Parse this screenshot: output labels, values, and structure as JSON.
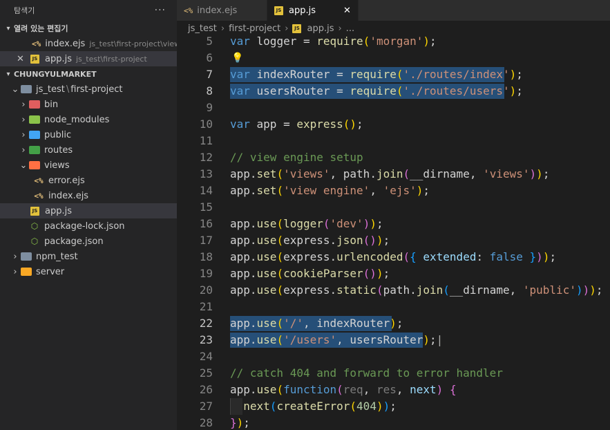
{
  "sidebar": {
    "title": "탐색기",
    "more": "···",
    "open_editors": {
      "label": "열려 있는 편집기",
      "items": [
        {
          "name": "index.ejs",
          "path": "js_test\\first-project\\views"
        },
        {
          "name": "app.js",
          "path": "js_test\\first-project"
        }
      ]
    },
    "workspace": {
      "label": "CHUNGYULMARKET",
      "root_label": "js_test",
      "root_label2": "first-project",
      "items": {
        "bin": "bin",
        "node_modules": "node_modules",
        "public": "public",
        "routes": "routes",
        "views": "views",
        "error_ejs": "error.ejs",
        "index_ejs": "index.ejs",
        "app_js": "app.js",
        "package_lock": "package-lock.json",
        "package_json": "package.json",
        "npm_test": "npm_test",
        "server": "server"
      }
    }
  },
  "tabs": [
    {
      "label": "index.ejs",
      "icon": "ejs-icon"
    },
    {
      "label": "app.js",
      "icon": "js-icon",
      "close": "✕"
    }
  ],
  "breadcrumb": [
    "js_test",
    "first-project",
    "app.js",
    "..."
  ],
  "editor": {
    "line_numbers": [
      "5",
      "6",
      "7",
      "8",
      "9",
      "10",
      "11",
      "12",
      "13",
      "14",
      "15",
      "16",
      "17",
      "18",
      "19",
      "20",
      "21",
      "22",
      "23",
      "24",
      "25",
      "26",
      "27",
      "28"
    ]
  },
  "colors": {
    "keyword": "#569cd6",
    "function": "#dcdcaa",
    "string": "#ce9178",
    "comment": "#6a9955",
    "selection": "#264f78"
  }
}
